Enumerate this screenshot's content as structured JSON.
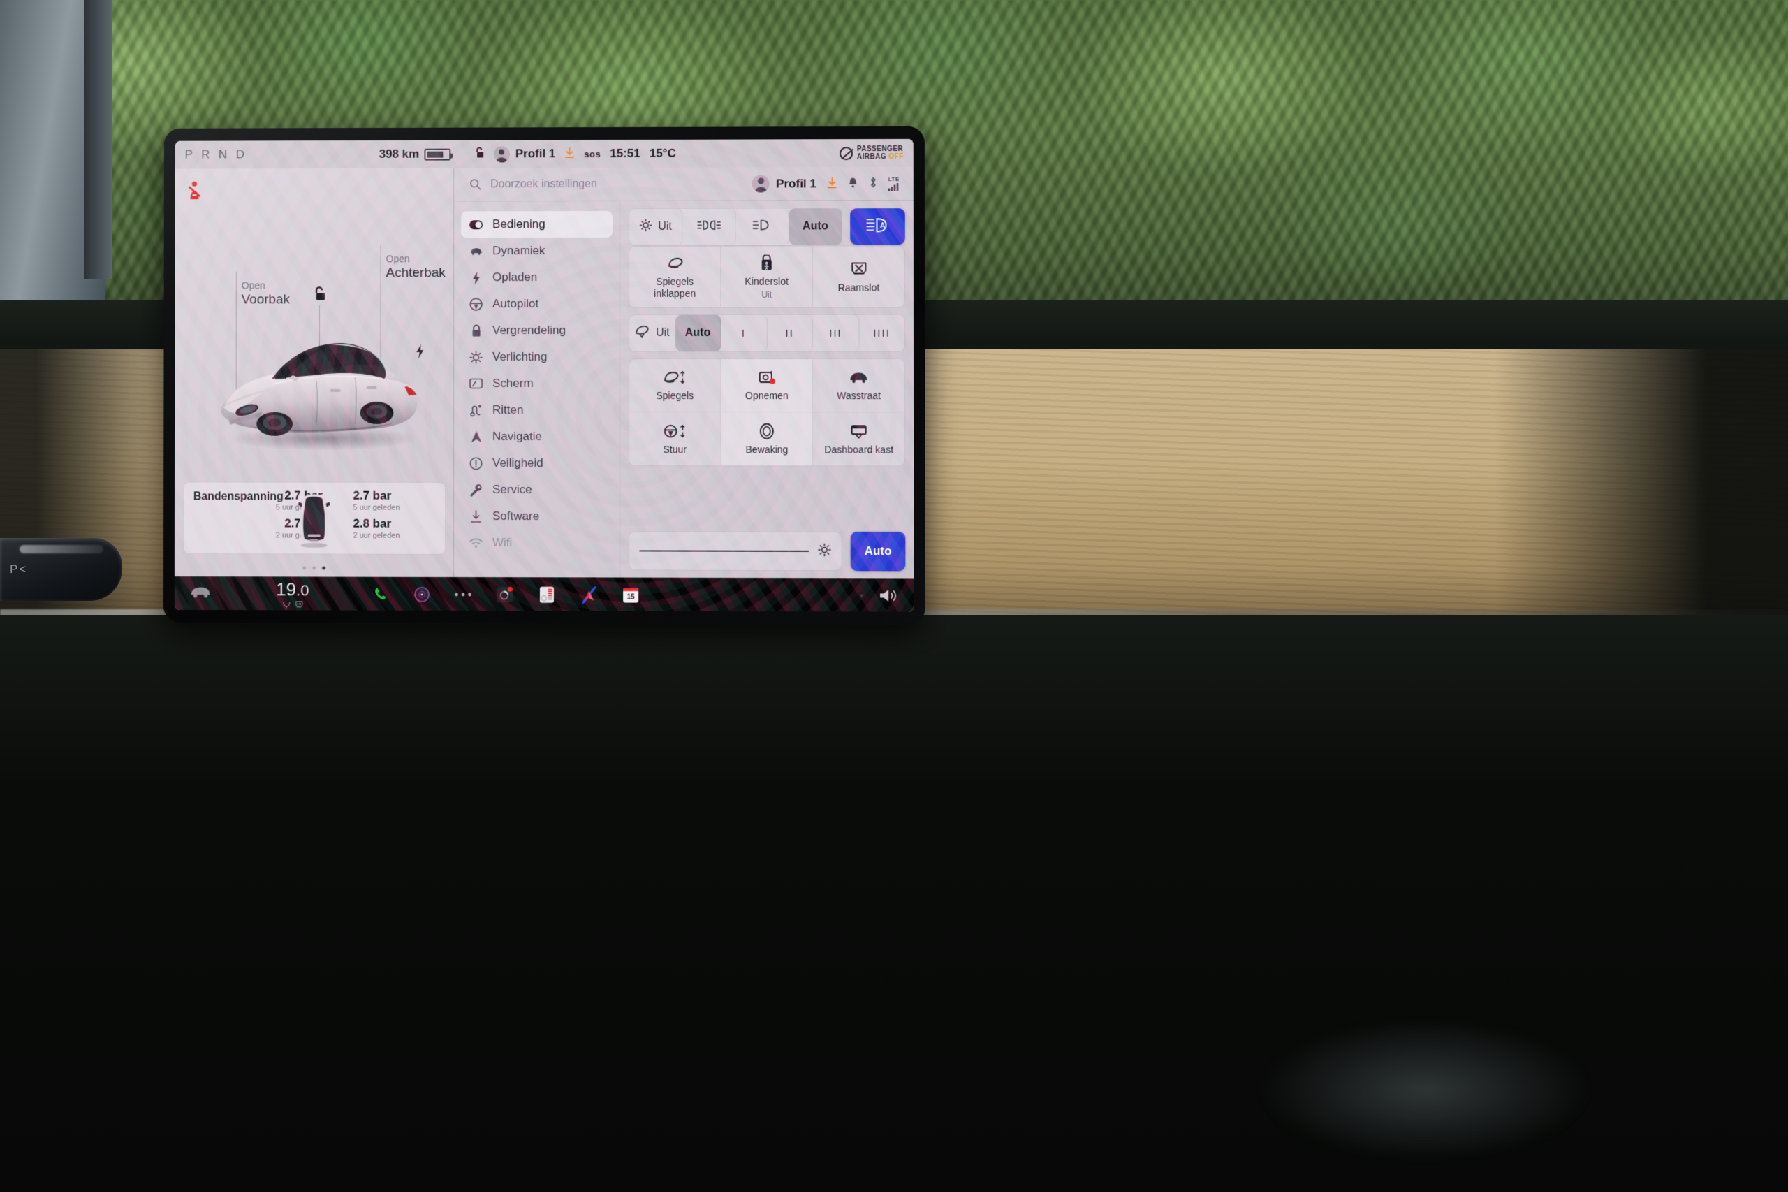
{
  "status_bar": {
    "prnd": {
      "p": "P",
      "r": "R",
      "n": "N",
      "d": "D",
      "active": "D"
    },
    "range": "398 km",
    "profile": "Profil 1",
    "sos": "sos",
    "time": "15:51",
    "temperature": "15°C",
    "airbag_line1": "PASSENGER",
    "airbag_line2": "AIRBAG",
    "airbag_state": "OFF"
  },
  "car_panel": {
    "front_trunk": {
      "action": "Open",
      "name": "Voorbak"
    },
    "rear_trunk": {
      "action": "Open",
      "name": "Achterbak"
    },
    "lock_state": "unlocked",
    "tire_pressure": {
      "title": "Bandenspanning",
      "front_left": {
        "value": "2.7 bar",
        "age": "5 uur geleden"
      },
      "front_right": {
        "value": "2.7 bar",
        "age": "5 uur geleden"
      },
      "rear_left": {
        "value": "2.7 bar",
        "age": "2 uur geleden"
      },
      "rear_right": {
        "value": "2.8 bar",
        "age": "2 uur geleden"
      }
    },
    "page_dots": {
      "count": 3,
      "active_index": 2
    }
  },
  "settings": {
    "search": {
      "placeholder": "Doorzoek instellingen",
      "value": ""
    },
    "profile": "Profil 1",
    "signal": "LTE",
    "sidebar": [
      {
        "label": "Bediening",
        "icon": "toggle-icon",
        "active": true
      },
      {
        "label": "Dynamiek",
        "icon": "car-icon",
        "active": false
      },
      {
        "label": "Opladen",
        "icon": "bolt-icon",
        "active": false
      },
      {
        "label": "Autopilot",
        "icon": "steering-icon",
        "active": false
      },
      {
        "label": "Vergrendeling",
        "icon": "lock-icon",
        "active": false
      },
      {
        "label": "Verlichting",
        "icon": "sun-icon",
        "active": false
      },
      {
        "label": "Scherm",
        "icon": "display-icon",
        "active": false
      },
      {
        "label": "Ritten",
        "icon": "route-icon",
        "active": false
      },
      {
        "label": "Navigatie",
        "icon": "navigation-icon",
        "active": false
      },
      {
        "label": "Veiligheid",
        "icon": "alert-icon",
        "active": false
      },
      {
        "label": "Service",
        "icon": "wrench-icon",
        "active": false
      },
      {
        "label": "Software",
        "icon": "download-icon",
        "active": false
      },
      {
        "label": "Wifi",
        "icon": "wifi-icon",
        "active": false
      }
    ],
    "headlights": {
      "options": [
        {
          "label": "Uit",
          "icon": "light-off-icon",
          "selected": false
        },
        {
          "label": "",
          "icon": "parking-light-icon",
          "selected": false
        },
        {
          "label": "",
          "icon": "low-beam-icon",
          "selected": false
        },
        {
          "label": "Auto",
          "icon": "",
          "selected": true
        }
      ],
      "highbeam_auto": {
        "icon": "auto-high-beam-icon",
        "active": true,
        "color": "#2b39d4"
      }
    },
    "mirrors_row": [
      {
        "label": "Spiegels\ninklappen",
        "label_line1": "Spiegels",
        "label_line2": "inklappen",
        "icon": "mirror-fold-icon",
        "sub": ""
      },
      {
        "label": "Kinderslot",
        "label_line1": "Kinderslot",
        "label_line2": "",
        "icon": "child-lock-icon",
        "sub": "Uit"
      },
      {
        "label": "Raamslot",
        "label_line1": "Raamslot",
        "label_line2": "",
        "icon": "window-lock-icon",
        "sub": ""
      }
    ],
    "wipers": {
      "options": [
        {
          "label": "Uit",
          "icon": "wiper-icon",
          "selected": false
        },
        {
          "label": "Auto",
          "icon": "",
          "selected": true
        },
        {
          "label": "I",
          "icon": "",
          "selected": false
        },
        {
          "label": "II",
          "icon": "",
          "selected": false
        },
        {
          "label": "III",
          "icon": "",
          "selected": false
        },
        {
          "label": "IIII",
          "icon": "",
          "selected": false
        }
      ]
    },
    "control_grid": [
      {
        "label": "Spiegels",
        "icon": "mirror-adjust-icon"
      },
      {
        "label": "Opnemen",
        "icon": "dashcam-record-icon"
      },
      {
        "label": "Wasstraat",
        "icon": "car-wash-icon"
      },
      {
        "label": "Stuur",
        "icon": "steering-adjust-icon"
      },
      {
        "label": "Bewaking",
        "icon": "sentry-mode-icon"
      },
      {
        "label": "Dashboard kast",
        "icon": "glovebox-icon"
      }
    ],
    "brightness": {
      "icon": "brightness-icon",
      "value_percent": 92,
      "auto_label": "Auto",
      "auto_active": true
    }
  },
  "dock": {
    "car_icon": "car-icon",
    "temperature": "19.0",
    "temperature_whole": "19",
    "temperature_dec": ".0",
    "icons": [
      {
        "name": "phone-icon"
      },
      {
        "name": "media-icon"
      },
      {
        "name": "more-icon"
      },
      {
        "name": "dashcam-icon"
      },
      {
        "name": "climate-icon"
      },
      {
        "name": "navigation-icon"
      },
      {
        "name": "calendar-icon",
        "badge": "15"
      },
      {
        "name": "volume-icon"
      }
    ],
    "calendar_day": "15"
  },
  "colors": {
    "accent_blue": "#2b39d4",
    "warning_red": "#e0201f",
    "amber": "#e08020",
    "lcd_bg": "#d0c9d1"
  }
}
